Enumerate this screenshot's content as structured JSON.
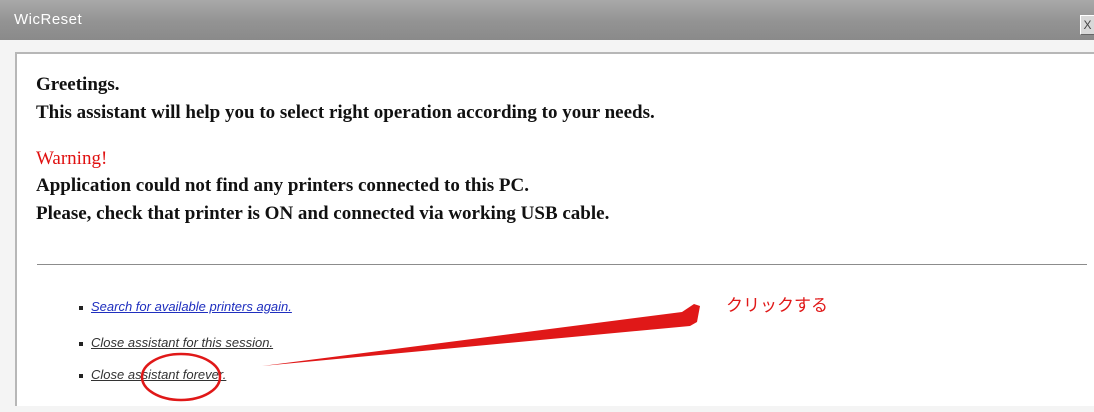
{
  "window": {
    "title": "WicReset",
    "close_label": "X"
  },
  "content": {
    "greeting": "Greetings.",
    "intro": "This assistant will help you to select right operation according to your needs.",
    "warning_label": "Warning!",
    "message_line1": "Application could not find any printers connected to this PC.",
    "message_line2": "Please, check that printer is ON and connected via working USB cable."
  },
  "options": [
    {
      "label": "Search for available printers again."
    },
    {
      "label": "Close assistant for this session."
    },
    {
      "label": "Close assistant forever."
    }
  ],
  "annotation": {
    "label": "クリックする",
    "color": "#e01818"
  },
  "colors": {
    "warning": "#e01010",
    "link": "#1f2fbf",
    "titlebar": "#999999"
  }
}
